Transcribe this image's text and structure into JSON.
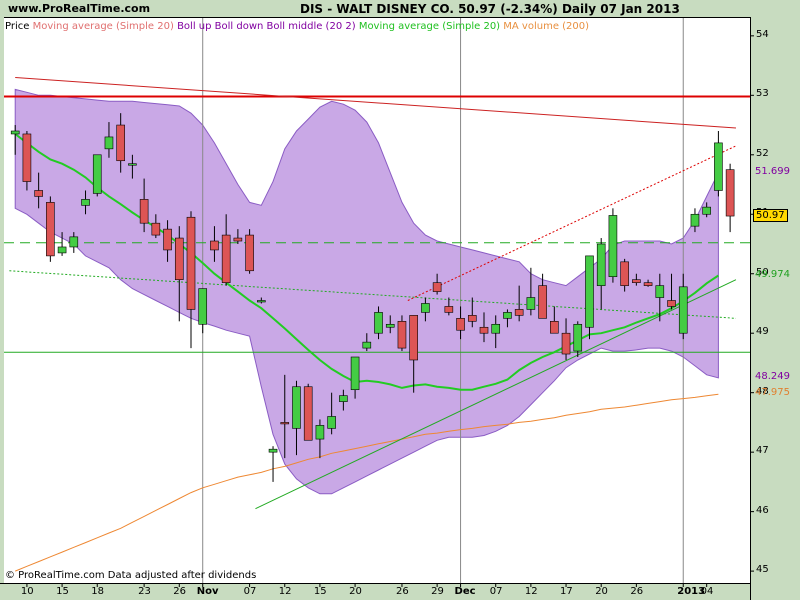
{
  "header": {
    "site": "www.ProRealTime.com",
    "title": "DIS - WALT DISNEY CO.    50.97 (-2.34%)    Daily  07 Jan 2013"
  },
  "legend": [
    {
      "text": "Price",
      "color": "#000000"
    },
    {
      "text": "Moving average (Simple 20)",
      "color": "#e07070"
    },
    {
      "text": "Boll up Boll down Boll middle (20 2)",
      "color": "#8000a0"
    },
    {
      "text": "Moving average (Simple 20)",
      "color": "#20c020"
    },
    {
      "text": "MA volume (200)",
      "color": "#e89040"
    }
  ],
  "footer": "© ProRealTime.com  Data adjusted after dividends",
  "colors": {
    "background": "#c8dcc0",
    "plot_bg": "#ffffff",
    "band_fill": "#c9a8e6",
    "band_edge": "#8a5cc4",
    "up_candle": "#44cc44",
    "down_candle": "#dd5555",
    "ma20": "#22cc22",
    "ma_volume": "#ee8833",
    "hline_red": "#dd0000",
    "hline_green": "#22aa22"
  },
  "price_labels": [
    {
      "text": "51.699",
      "color": "#8000a0",
      "bg": "",
      "value": 51.7
    },
    {
      "text": "50.97",
      "color": "#000000",
      "bg": "#ffd800",
      "value": 50.97
    },
    {
      "text": "49.974",
      "color": "#20a020",
      "bg": "",
      "value": 49.97
    },
    {
      "text": "48.249",
      "color": "#8000a0",
      "bg": "",
      "value": 48.25
    },
    {
      "text": "47.975",
      "color": "#e08030",
      "bg": "",
      "value": 47.97
    }
  ],
  "chart_data": {
    "type": "candlestick",
    "title": "DIS - WALT DISNEY CO.",
    "ylim": [
      44.8,
      54.3
    ],
    "y_ticks": [
      "45",
      "46",
      "47",
      "48",
      "49",
      "50",
      "51",
      "52",
      "53",
      "54"
    ],
    "x_ticks": [
      "10",
      "15",
      "18",
      "23",
      "26",
      "Nov",
      "07",
      "12",
      "15",
      "20",
      "26",
      "29",
      "Dec",
      "07",
      "12",
      "17",
      "20",
      "26",
      "2013",
      "04"
    ],
    "x_tick_index": [
      1,
      4,
      7,
      11,
      14,
      16,
      20,
      23,
      26,
      29,
      33,
      36,
      38,
      41,
      44,
      47,
      50,
      53,
      57,
      59
    ],
    "ohlc": [
      [
        52.35,
        52.5,
        52.0,
        52.4
      ],
      [
        52.35,
        52.4,
        51.4,
        51.55
      ],
      [
        51.4,
        51.7,
        51.1,
        51.3
      ],
      [
        51.2,
        51.3,
        50.2,
        50.3
      ],
      [
        50.35,
        50.7,
        50.3,
        50.45
      ],
      [
        50.45,
        50.7,
        50.35,
        50.62
      ],
      [
        51.15,
        51.4,
        51.0,
        51.25
      ],
      [
        51.35,
        52.0,
        51.3,
        52.0
      ],
      [
        52.1,
        52.55,
        51.95,
        52.3
      ],
      [
        52.5,
        52.7,
        51.7,
        51.9
      ],
      [
        51.85,
        52.0,
        51.6,
        51.85
      ],
      [
        51.25,
        51.6,
        50.7,
        50.85
      ],
      [
        50.85,
        51.0,
        50.6,
        50.65
      ],
      [
        50.75,
        50.9,
        50.2,
        50.4
      ],
      [
        50.6,
        50.8,
        49.2,
        49.9
      ],
      [
        50.95,
        51.05,
        48.75,
        49.4
      ],
      [
        49.15,
        49.75,
        49.0,
        49.75
      ],
      [
        50.55,
        50.8,
        50.2,
        50.4
      ],
      [
        50.65,
        51.0,
        49.8,
        49.85
      ],
      [
        50.6,
        50.75,
        50.5,
        50.55
      ],
      [
        50.65,
        50.75,
        50.0,
        50.05
      ],
      [
        49.55,
        49.6,
        49.5,
        49.55
      ],
      [
        47.0,
        47.1,
        46.5,
        47.05
      ],
      [
        47.5,
        48.3,
        46.9,
        47.48
      ],
      [
        47.4,
        48.2,
        46.95,
        48.1
      ],
      [
        48.1,
        48.15,
        47.2,
        47.2
      ],
      [
        47.22,
        47.55,
        46.9,
        47.45
      ],
      [
        47.4,
        48.0,
        47.3,
        47.6
      ],
      [
        47.85,
        48.05,
        47.7,
        47.95
      ],
      [
        48.05,
        48.6,
        47.9,
        48.6
      ],
      [
        48.75,
        49.0,
        48.7,
        48.85
      ],
      [
        49.0,
        49.45,
        48.9,
        49.35
      ],
      [
        49.1,
        49.3,
        49.0,
        49.15
      ],
      [
        49.2,
        49.3,
        48.7,
        48.75
      ],
      [
        49.3,
        49.3,
        48.0,
        48.55
      ],
      [
        49.35,
        49.6,
        49.2,
        49.5
      ],
      [
        49.85,
        50.0,
        49.65,
        49.7
      ],
      [
        49.45,
        49.6,
        49.3,
        49.35
      ],
      [
        49.25,
        49.45,
        48.9,
        49.05
      ],
      [
        49.3,
        49.6,
        49.1,
        49.2
      ],
      [
        49.1,
        49.35,
        48.85,
        49.0
      ],
      [
        49.0,
        49.3,
        48.75,
        49.15
      ],
      [
        49.25,
        49.4,
        49.1,
        49.35
      ],
      [
        49.4,
        49.8,
        49.2,
        49.3
      ],
      [
        49.4,
        50.1,
        49.3,
        49.6
      ],
      [
        49.8,
        50.0,
        49.3,
        49.25
      ],
      [
        49.2,
        49.45,
        49.0,
        49.0
      ],
      [
        49.0,
        49.25,
        48.55,
        48.65
      ],
      [
        48.7,
        49.2,
        48.6,
        49.15
      ],
      [
        49.1,
        50.3,
        48.9,
        50.3
      ],
      [
        49.8,
        50.6,
        49.4,
        50.5
      ],
      [
        49.95,
        51.1,
        49.85,
        50.98
      ],
      [
        50.2,
        50.25,
        49.7,
        49.8
      ],
      [
        49.9,
        50.0,
        49.8,
        49.85
      ],
      [
        49.85,
        49.9,
        49.78,
        49.8
      ],
      [
        49.6,
        50.0,
        49.2,
        49.8
      ],
      [
        49.55,
        50.0,
        49.4,
        49.45
      ],
      [
        49.0,
        50.0,
        48.9,
        49.78
      ],
      [
        50.8,
        51.1,
        50.7,
        51.0
      ],
      [
        51.0,
        51.2,
        50.95,
        51.12
      ],
      [
        51.4,
        52.4,
        51.3,
        52.2
      ],
      [
        51.75,
        51.85,
        50.7,
        50.97
      ]
    ],
    "ma20": [
      52.35,
      52.2,
      52.05,
      51.92,
      51.85,
      51.75,
      51.62,
      51.45,
      51.3,
      51.17,
      51.03,
      50.9,
      50.78,
      50.65,
      50.5,
      50.35,
      50.18,
      50.0,
      49.85,
      49.7,
      49.55,
      49.42,
      49.25,
      49.08,
      48.9,
      48.72,
      48.55,
      48.4,
      48.28,
      48.18,
      48.2,
      48.18,
      48.14,
      48.08,
      48.12,
      48.14,
      48.1,
      48.08,
      48.05,
      48.05,
      48.1,
      48.15,
      48.22,
      48.38,
      48.5,
      48.6,
      48.68,
      48.78,
      48.88,
      48.98,
      49.0,
      49.05,
      49.1,
      49.18,
      49.25,
      49.32,
      49.42,
      49.54,
      49.68,
      49.84,
      49.97
    ],
    "boll_up": [
      53.1,
      53.05,
      53.0,
      53.0,
      52.98,
      52.96,
      52.94,
      52.92,
      52.9,
      52.9,
      52.9,
      52.88,
      52.86,
      52.84,
      52.82,
      52.7,
      52.5,
      52.2,
      51.85,
      51.5,
      51.2,
      51.15,
      51.55,
      52.1,
      52.4,
      52.6,
      52.8,
      52.9,
      52.85,
      52.75,
      52.55,
      52.2,
      51.7,
      51.2,
      50.85,
      50.65,
      50.55,
      50.5,
      50.45,
      50.4,
      50.35,
      50.3,
      50.25,
      50.2,
      50.0,
      49.9,
      49.85,
      49.8,
      49.95,
      50.1,
      50.25,
      50.48,
      50.55,
      50.55,
      50.55,
      50.55,
      50.5,
      50.6,
      50.9,
      51.3,
      51.7
    ],
    "boll_down": [
      51.1,
      51.0,
      50.85,
      50.7,
      50.6,
      50.5,
      50.3,
      50.2,
      50.1,
      49.9,
      49.75,
      49.65,
      49.55,
      49.45,
      49.35,
      49.25,
      49.18,
      49.12,
      49.05,
      49.0,
      48.95,
      48.1,
      47.3,
      46.8,
      46.55,
      46.4,
      46.3,
      46.3,
      46.4,
      46.5,
      46.6,
      46.7,
      46.8,
      46.9,
      47.0,
      47.1,
      47.2,
      47.25,
      47.25,
      47.25,
      47.28,
      47.35,
      47.45,
      47.6,
      47.8,
      48.0,
      48.2,
      48.42,
      48.55,
      48.65,
      48.75,
      48.7,
      48.7,
      48.72,
      48.75,
      48.75,
      48.7,
      48.6,
      48.45,
      48.3,
      48.25
    ],
    "ma_volume": [
      45.0,
      45.08,
      45.16,
      45.24,
      45.32,
      45.4,
      45.48,
      45.56,
      45.64,
      45.72,
      45.82,
      45.92,
      46.02,
      46.12,
      46.22,
      46.32,
      46.4,
      46.46,
      46.52,
      46.58,
      46.62,
      46.66,
      46.72,
      46.76,
      46.82,
      46.88,
      46.92,
      46.98,
      47.02,
      47.06,
      47.1,
      47.14,
      47.18,
      47.22,
      47.26,
      47.3,
      47.32,
      47.35,
      47.38,
      47.4,
      47.43,
      47.45,
      47.47,
      47.5,
      47.52,
      47.55,
      47.58,
      47.62,
      47.65,
      47.68,
      47.72,
      47.74,
      47.76,
      47.79,
      47.82,
      47.85,
      47.88,
      47.9,
      47.92,
      47.95,
      47.975
    ],
    "hlines": [
      {
        "value": 52.98,
        "color": "#dd0000",
        "style": "solid"
      },
      {
        "value": 50.52,
        "color": "#22aa22",
        "style": "dashed"
      },
      {
        "value": 48.68,
        "color": "#22aa22",
        "style": "solid"
      }
    ],
    "trendlines": [
      {
        "from": [
          0,
          53.3
        ],
        "to": [
          61.5,
          52.45
        ],
        "color": "#cc2222",
        "style": "solid"
      },
      {
        "from": [
          -0.5,
          50.05
        ],
        "to": [
          61.5,
          49.25
        ],
        "color": "#22aa22",
        "style": "dotted"
      },
      {
        "from": [
          20.5,
          46.05
        ],
        "to": [
          61.5,
          49.9
        ],
        "color": "#22aa22",
        "style": "solid"
      },
      {
        "from": [
          33.5,
          49.55
        ],
        "to": [
          61.5,
          52.15
        ],
        "color": "#dd0000",
        "style": "dotted"
      }
    ],
    "vlines": [
      16,
      38,
      57
    ]
  }
}
